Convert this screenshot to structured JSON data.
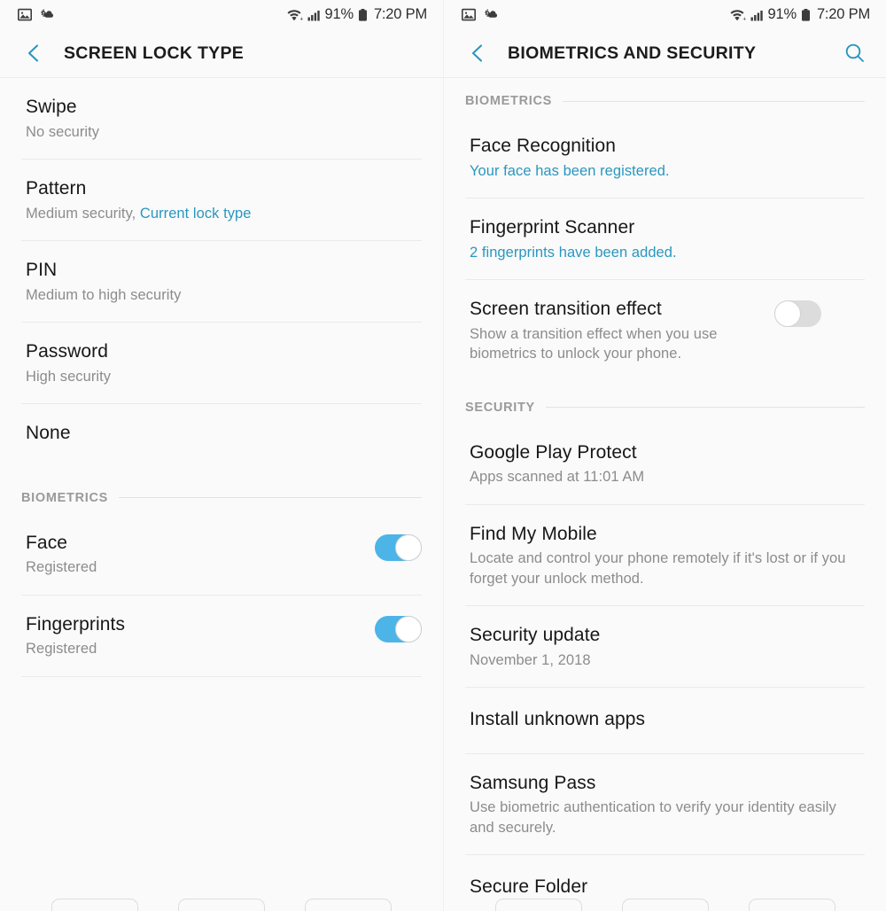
{
  "status_bar": {
    "icons_left": [
      "image-icon",
      "weather-partly-cloudy-icon"
    ],
    "wifi_icon": "wifi-icon",
    "signal_icon": "cellular-signal-icon",
    "battery_percent": "91%",
    "battery_icon": "battery-icon",
    "clock": "7:20 PM"
  },
  "colors": {
    "accent": "#2a97c0",
    "toggle_on": "#4cb4e7",
    "toggle_off": "#dcdcdc",
    "background": "#fafafa",
    "title": "#1c1c1c",
    "secondary_text": "#8c8c8c"
  },
  "left_panel": {
    "appbar": {
      "back_icon": "chevron-left-icon",
      "title": "SCREEN LOCK TYPE"
    },
    "items": [
      {
        "title": "Swipe",
        "sub": "No security"
      },
      {
        "title": "Pattern",
        "sub": "Medium security, ",
        "sub_link": "Current lock type"
      },
      {
        "title": "PIN",
        "sub": "Medium to high security"
      },
      {
        "title": "Password",
        "sub": "High security"
      },
      {
        "title": "None",
        "sub": ""
      }
    ],
    "section": {
      "label": "BIOMETRICS"
    },
    "biometric_items": [
      {
        "title": "Face",
        "sub": "Registered",
        "toggle": "on"
      },
      {
        "title": "Fingerprints",
        "sub": "Registered",
        "toggle": "on"
      }
    ]
  },
  "right_panel": {
    "appbar": {
      "back_icon": "chevron-left-icon",
      "title": "BIOMETRICS AND SECURITY",
      "search_icon": "search-icon"
    },
    "biometrics_section": {
      "label": "BIOMETRICS"
    },
    "biometrics_items": [
      {
        "title": "Face Recognition",
        "sub": "Your face has been registered.",
        "sub_accent": true
      },
      {
        "title": "Fingerprint Scanner",
        "sub": "2 fingerprints have been added.",
        "sub_accent": true
      },
      {
        "title": "Screen transition effect",
        "sub": "Show a transition effect when you use biometrics to unlock your phone.",
        "toggle": "off"
      }
    ],
    "security_section": {
      "label": "SECURITY"
    },
    "security_items": [
      {
        "title": "Google Play Protect",
        "sub": "Apps scanned at 11:01 AM"
      },
      {
        "title": "Find My Mobile",
        "sub": "Locate and control your phone remotely if it's lost or if you forget your unlock method."
      },
      {
        "title": "Security update",
        "sub": "November 1, 2018"
      },
      {
        "title": "Install unknown apps",
        "sub": ""
      },
      {
        "title": "Samsung Pass",
        "sub": "Use biometric authentication to verify your identity easily and securely."
      },
      {
        "title": "Secure Folder",
        "sub": ""
      }
    ]
  }
}
